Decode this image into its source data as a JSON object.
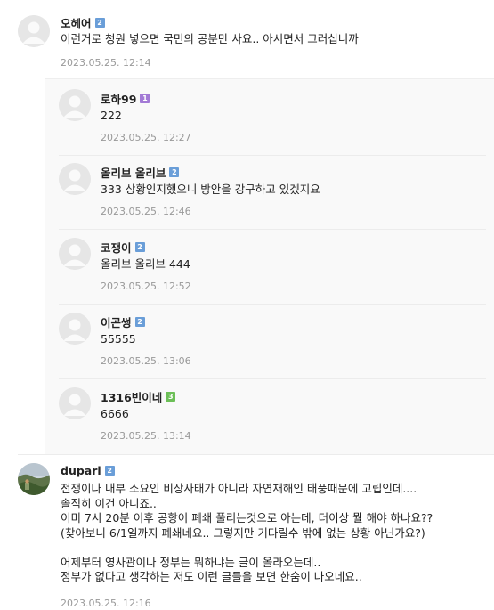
{
  "colors": {
    "badge_blue": "#6a9ed8",
    "badge_purple": "#a37ad6",
    "badge_green": "#6cbf57"
  },
  "comments": [
    {
      "nick": "오헤어",
      "badge": "2",
      "text": "이런거로 청원 넣으면 국민의 공분만 사요.. 아시면서 그러십니까",
      "date": "2023.05.25. 12:14"
    },
    {
      "nick": "dupari",
      "badge": "2",
      "text": "전쟁이나 내부 소요인 비상사태가 아니라 자연재해인 태풍때문에 고립인데....\n솔직히 이건 아니죠..\n이미 7시 20분 이후 공항이 폐쇄 풀리는것으로 아는데, 더이상 뭘 해야 하나요??\n(찾아보니 6/1일까지 폐쇄네요.. 그렇지만 기다릴수 밖에 없는 상황 아닌가요?)\n\n어제부터 영사관이나 정부는 뭐하냐는 글이 올라오는데..\n정부가 없다고 생각하는 저도 이런 글들을 보면 한숨이 나오네요..",
      "date": "2023.05.25. 12:16"
    }
  ],
  "replies": [
    {
      "nick": "로하99",
      "badge": "1",
      "text": "222",
      "date": "2023.05.25. 12:27"
    },
    {
      "nick": "올리브 올리브",
      "badge": "2",
      "text": "333 상황인지했으니 방안을 강구하고 있겠지요",
      "date": "2023.05.25. 12:46"
    },
    {
      "nick": "코쟁이",
      "badge": "2",
      "text": "올리브 올리브 444",
      "date": "2023.05.25. 12:52"
    },
    {
      "nick": "이곤썽",
      "badge": "2",
      "text": "55555",
      "date": "2023.05.25. 13:06"
    },
    {
      "nick": "1316빈이네",
      "badge": "3",
      "text": "6666",
      "date": "2023.05.25. 13:14"
    }
  ]
}
